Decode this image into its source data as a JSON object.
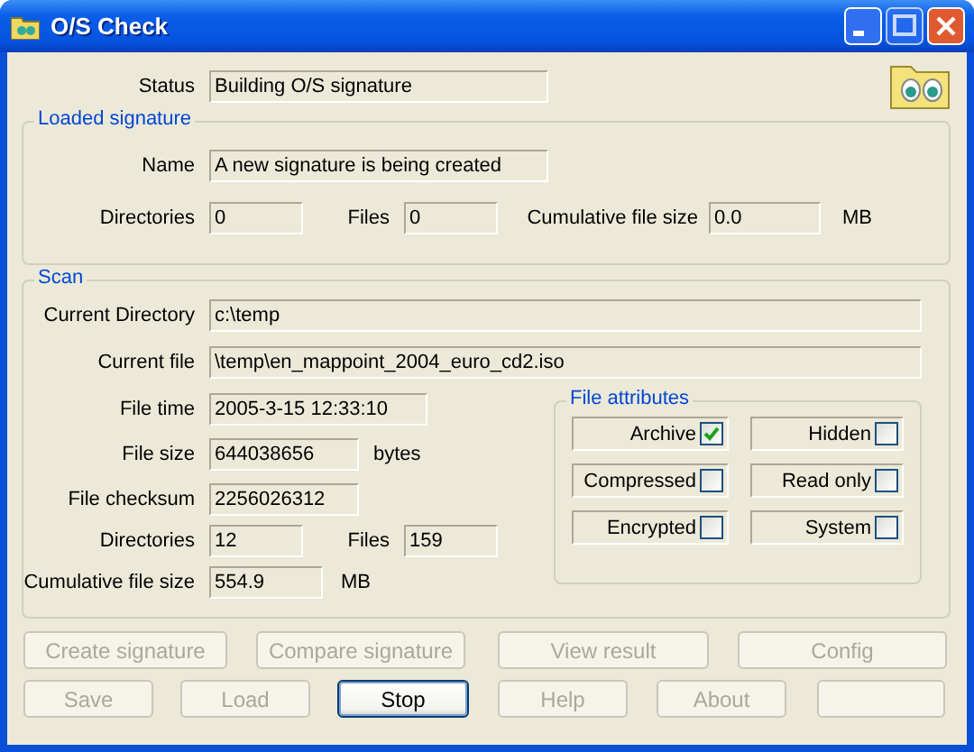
{
  "window": {
    "title": "O/S Check"
  },
  "status": {
    "label": "Status",
    "value": "Building O/S signature"
  },
  "loaded_signature": {
    "title": "Loaded signature",
    "name": {
      "label": "Name",
      "value": "A new signature is being created"
    },
    "directories": {
      "label": "Directories",
      "value": "0"
    },
    "files": {
      "label": "Files",
      "value": "0"
    },
    "cumulative_size": {
      "label": "Cumulative file size",
      "value": "0.0",
      "unit": "MB"
    }
  },
  "scan": {
    "title": "Scan",
    "current_directory": {
      "label": "Current Directory",
      "value": "c:\\temp"
    },
    "current_file": {
      "label": "Current file",
      "value": "\\temp\\en_mappoint_2004_euro_cd2.iso"
    },
    "file_time": {
      "label": "File time",
      "value": "2005-3-15 12:33:10"
    },
    "file_size": {
      "label": "File size",
      "value": "644038656",
      "unit": "bytes"
    },
    "file_checksum": {
      "label": "File checksum",
      "value": "2256026312"
    },
    "directories": {
      "label": "Directories",
      "value": "12"
    },
    "files": {
      "label": "Files",
      "value": "159"
    },
    "cumulative_size": {
      "label": "Cumulative file size",
      "value": "554.9",
      "unit": "MB"
    },
    "file_attributes": {
      "title": "File attributes",
      "items": [
        {
          "label": "Archive",
          "checked": true
        },
        {
          "label": "Hidden",
          "checked": false
        },
        {
          "label": "Compressed",
          "checked": false
        },
        {
          "label": "Read only",
          "checked": false
        },
        {
          "label": "Encrypted",
          "checked": false
        },
        {
          "label": "System",
          "checked": false
        }
      ]
    }
  },
  "button_rows": [
    {
      "buttons": [
        {
          "label": "Create signature",
          "disabled": true
        },
        {
          "label": "Compare signature",
          "disabled": true
        },
        {
          "label": "View result",
          "disabled": true
        },
        {
          "label": "Config",
          "disabled": true
        }
      ]
    },
    {
      "buttons": [
        {
          "label": "Save",
          "disabled": true
        },
        {
          "label": "Load",
          "disabled": true
        },
        {
          "label": "Stop",
          "disabled": false
        },
        {
          "label": "Help",
          "disabled": true
        },
        {
          "label": "About",
          "disabled": true
        },
        {
          "disabled": true
        }
      ]
    }
  ]
}
